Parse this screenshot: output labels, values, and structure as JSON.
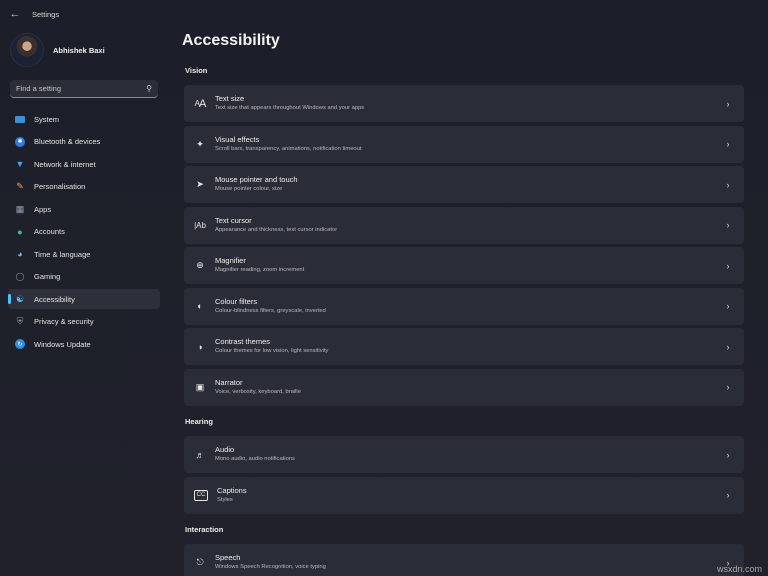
{
  "app": {
    "title": "Settings",
    "back_icon": "back-arrow-icon"
  },
  "profile": {
    "name": "Abhishek Baxi"
  },
  "search": {
    "placeholder": "Find a setting"
  },
  "nav": [
    {
      "label": "System",
      "icon": "monitor-icon",
      "color": "#3a8fd9"
    },
    {
      "label": "Bluetooth & devices",
      "icon": "bluetooth-icon",
      "color": "#2f7de1"
    },
    {
      "label": "Network & internet",
      "icon": "wifi-icon",
      "color": "#4aa3e8"
    },
    {
      "label": "Personalisation",
      "icon": "paintbrush-icon",
      "color": "#e0a35a"
    },
    {
      "label": "Apps",
      "icon": "apps-icon",
      "color": "#9aa2b8"
    },
    {
      "label": "Accounts",
      "icon": "person-icon",
      "color": "#3fbf8f"
    },
    {
      "label": "Time & language",
      "icon": "globe-clock-icon",
      "color": "#6fb6e8"
    },
    {
      "label": "Gaming",
      "icon": "gamepad-icon",
      "color": "#8c95a8"
    },
    {
      "label": "Accessibility",
      "icon": "accessibility-icon",
      "color": "#4cc2ff",
      "active": true
    },
    {
      "label": "Privacy & security",
      "icon": "shield-icon",
      "color": "#8e95a6"
    },
    {
      "label": "Windows Update",
      "icon": "update-icon",
      "color": "#2f8fe6"
    }
  ],
  "page": {
    "title": "Accessibility"
  },
  "sections": {
    "vision": "Vision",
    "hearing": "Hearing",
    "interaction": "Interaction"
  },
  "cards": {
    "text_size": {
      "title": "Text size",
      "subtitle": "Text size that appears throughout Windows and your apps",
      "icon": "text-size-icon"
    },
    "visual_effects": {
      "title": "Visual effects",
      "subtitle": "Scroll bars, transparency, animations, notification timeout",
      "icon": "sparkle-icon"
    },
    "mouse_pointer": {
      "title": "Mouse pointer and touch",
      "subtitle": "Mouse pointer colour, size",
      "icon": "mouse-pointer-icon"
    },
    "text_cursor": {
      "title": "Text cursor",
      "subtitle": "Appearance and thickness, text cursor indicator",
      "icon": "text-cursor-icon"
    },
    "magnifier": {
      "title": "Magnifier",
      "subtitle": "Magnifier reading, zoom increment",
      "icon": "magnifier-icon"
    },
    "colour_filters": {
      "title": "Colour filters",
      "subtitle": "Colour-blindness filters, greyscale, inverted",
      "icon": "colour-filters-icon"
    },
    "contrast_themes": {
      "title": "Contrast themes",
      "subtitle": "Colour themes for low vision, light sensitivity",
      "icon": "contrast-icon"
    },
    "narrator": {
      "title": "Narrator",
      "subtitle": "Voice, verbosity, keyboard, braille",
      "icon": "narrator-icon"
    },
    "audio": {
      "title": "Audio",
      "subtitle": "Mono audio, audio notifications",
      "icon": "speaker-icon"
    },
    "captions": {
      "title": "Captions",
      "subtitle": "Styles",
      "icon": "captions-icon"
    },
    "speech": {
      "title": "Speech",
      "subtitle": "Windows Speech Recognition, voice typing",
      "icon": "microphone-icon"
    }
  },
  "watermark": "wsxdn.com"
}
